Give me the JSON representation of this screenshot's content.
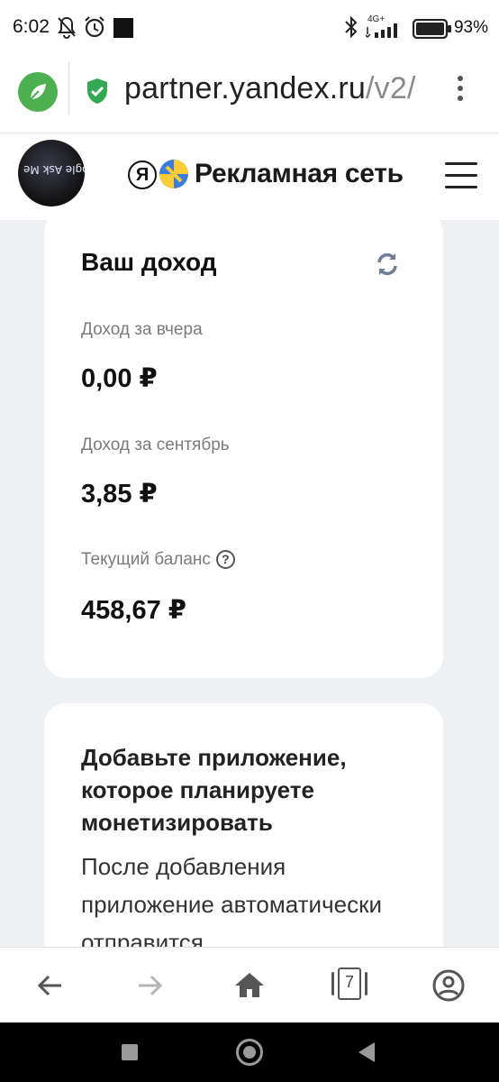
{
  "status_bar": {
    "time": "6:02",
    "network": "4G+",
    "battery": "93%"
  },
  "browser": {
    "url_main": "partner.yandex.ru",
    "url_path": "/v2/",
    "tabs_count": "7"
  },
  "header": {
    "logo_letter": "Я",
    "brand": "Рекламная сеть",
    "avatar_text": "FuckGoogle Ask Me"
  },
  "income_card": {
    "title": "Ваш доход",
    "yesterday_label": "Доход за вчера",
    "yesterday_value": "0,00 ₽",
    "month_label": "Доход за сентябрь",
    "month_value": "3,85 ₽",
    "balance_label": "Текущий баланс",
    "balance_help": "?",
    "balance_value": "458,67 ₽"
  },
  "app_card": {
    "title": "Добавьте приложение, которое планируете монетизировать",
    "description": "После добавления приложение автоматически отправится"
  },
  "colors": {
    "page_bg": "#eef0f4",
    "card_bg": "#ffffff",
    "accent_green": "#4caf50",
    "yandex_yellow": "#fc3",
    "yandex_blue": "#3b7ddd"
  }
}
